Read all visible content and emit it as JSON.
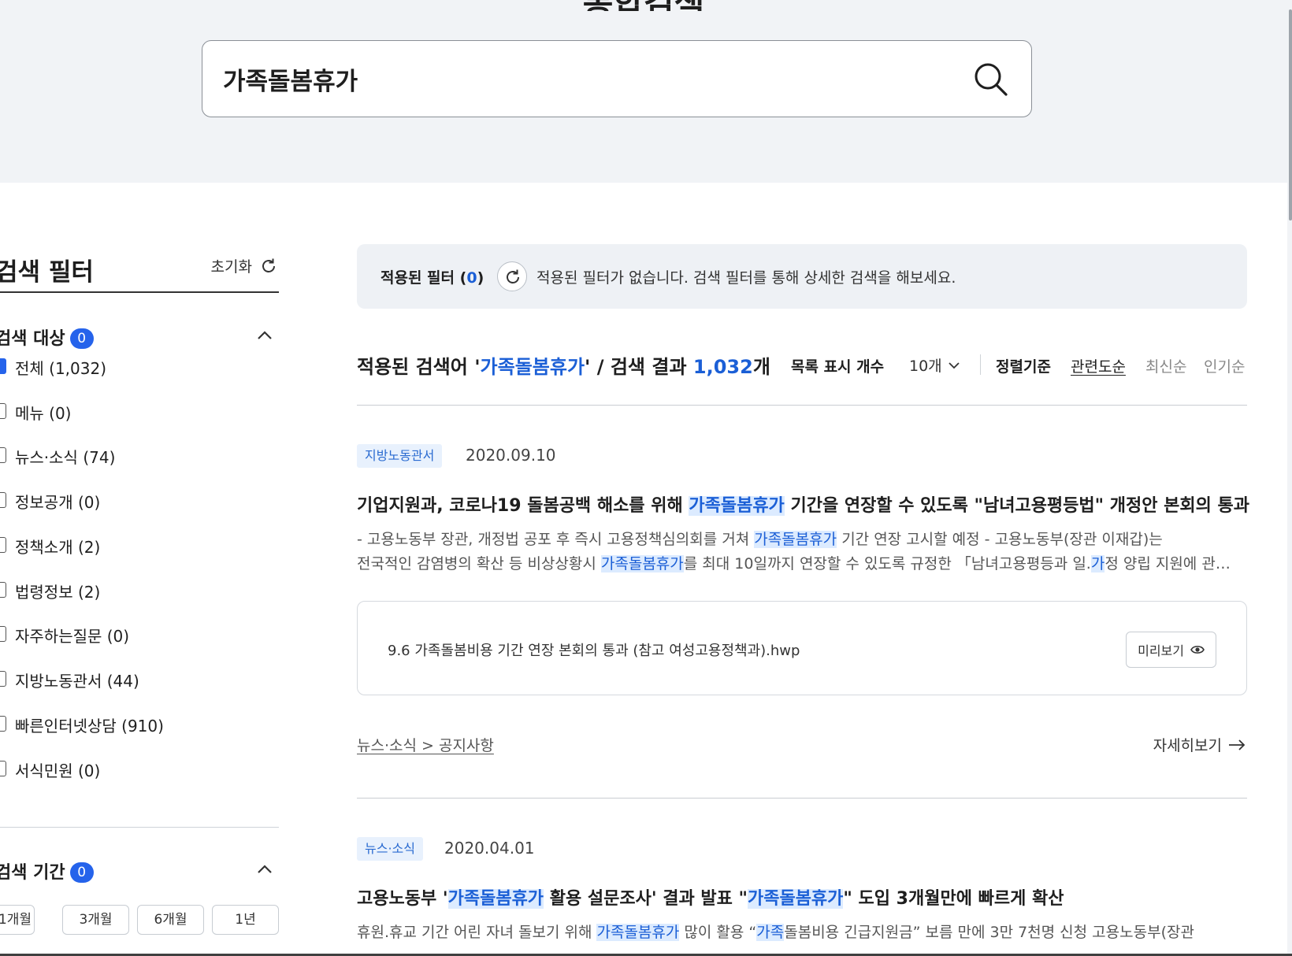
{
  "header": {
    "title": "통합검색"
  },
  "search": {
    "value": "가족돌봄휴가"
  },
  "sidebar": {
    "title": "검색 필터",
    "reset_label": "초기화",
    "target": {
      "title": "검색 대상",
      "badge": "0",
      "items": [
        {
          "label": "전체 (1,032)",
          "checked": true
        },
        {
          "label": "메뉴 (0)",
          "checked": false
        },
        {
          "label": "뉴스·소식 (74)",
          "checked": false
        },
        {
          "label": "정보공개 (0)",
          "checked": false
        },
        {
          "label": "정책소개 (2)",
          "checked": false
        },
        {
          "label": "법령정보 (2)",
          "checked": false
        },
        {
          "label": "자주하는질문 (0)",
          "checked": false
        },
        {
          "label": "지방노동관서 (44)",
          "checked": false
        },
        {
          "label": "빠른인터넷상담 (910)",
          "checked": false
        },
        {
          "label": "서식민원 (0)",
          "checked": false
        }
      ]
    },
    "period": {
      "title": "검색 기간",
      "badge": "0",
      "buttons": [
        "1개월",
        "3개월",
        "6개월",
        "1년"
      ]
    }
  },
  "filter_bar": {
    "label": "적용된 필터 (",
    "count": "0",
    "label_end": ")",
    "message": "적용된 필터가 없습니다. 검색 필터를 통해 상세한 검색을 해보세요."
  },
  "results_header": {
    "prefix": "적용된 검색어 '",
    "query": "가족돌봄휴가",
    "middle": "' / 검색 결과 ",
    "count": "1,032",
    "suffix": "개",
    "list_count_label": "목록 표시 개수",
    "list_count_value": "10개",
    "sort_label": "정렬기준",
    "sort_options": [
      "관련도순",
      "최신순",
      "인기순"
    ]
  },
  "results": [
    {
      "category": "지방노동관서",
      "date": "2020.09.10",
      "title": {
        "pre": "기업지원과, 코로나19 돌봄공백 해소를 위해 ",
        "hl": "가족돌봄휴가",
        "post": " 기간을 연장할 수 있도록 \"남녀고용평등법\" 개정안 본회의 통과"
      },
      "desc_line1": {
        "pre": "- 고용노동부 장관, 개정법 공포 후 즉시 고용정책심의회를 거쳐 ",
        "hl": "가족돌봄휴가",
        "post": " 기간 연장 고시할 예정 - 고용노동부(장관 이재갑)는"
      },
      "desc_line2": {
        "pre": "전국적인 감염병의 확산 등 비상상황시 ",
        "hl": "가족돌봄휴가",
        "mid": "를 최대 10일까지 연장할 수 있도록 규정한 「남녀고용평등과 일.",
        "hl2": "가",
        "post": "정 양립 지원에 관한 법률」"
      },
      "attachment": "9.6 가족돌봄비용 기간 연장 본회의 통과 (참고 여성고용정책과).hwp",
      "preview_label": "미리보기",
      "breadcrumb": "뉴스·소식 > 공지사항",
      "detail_label": "자세히보기"
    },
    {
      "category": "뉴스·소식",
      "date": "2020.04.01",
      "title": {
        "pre": "고용노동부 '",
        "hl": "가족돌봄휴가",
        "mid": " 활용 설문조사' 결과 발표 \"",
        "hl2": "가족돌봄휴가",
        "post": "\" 도입 3개월만에 빠르게 확산"
      },
      "desc_line1": {
        "pre": "휴원.휴교 기간 어린 자녀 돌보기 위해 ",
        "hl": "가족돌봄휴가",
        "mid": " 많이 활용 “",
        "hl2": "가족",
        "post": "돌봄비용 긴급지원금” 보름 만에 3만 7천명 신청 고용노동부(장관"
      }
    }
  ]
}
